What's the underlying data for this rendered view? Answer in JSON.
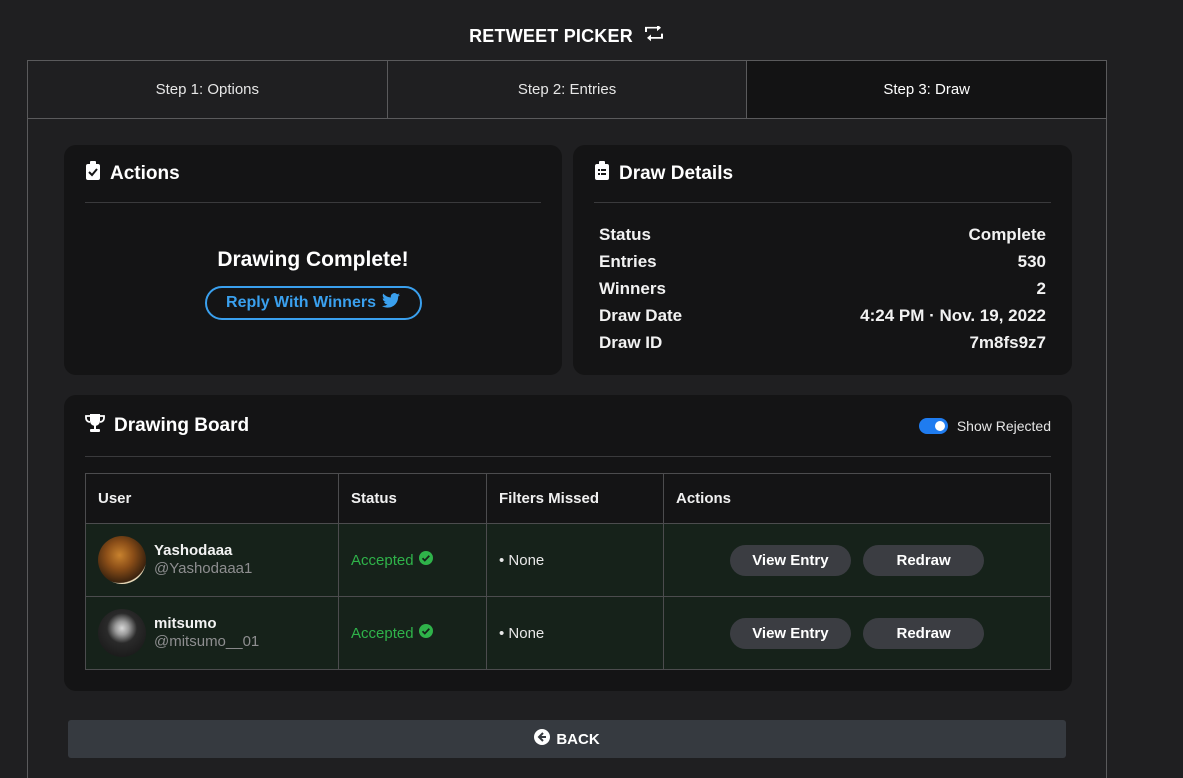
{
  "header": {
    "title": "RETWEET PICKER",
    "icon": "retweet-icon"
  },
  "tabs": [
    {
      "label": "Step 1: Options",
      "active": false
    },
    {
      "label": "Step 2: Entries",
      "active": false
    },
    {
      "label": "Step 3: Draw",
      "active": true
    }
  ],
  "actions_card": {
    "title": "Actions",
    "icon": "clipboard-check-icon",
    "message": "Drawing Complete!",
    "reply_button": "Reply With Winners",
    "reply_icon": "twitter-icon"
  },
  "details_card": {
    "title": "Draw Details",
    "icon": "clipboard-list-icon",
    "rows": [
      {
        "label": "Status",
        "value": "Complete"
      },
      {
        "label": "Entries",
        "value": "530"
      },
      {
        "label": "Winners",
        "value": "2"
      },
      {
        "label": "Draw Date",
        "value": "4:24 PM · Nov. 19, 2022"
      },
      {
        "label": "Draw ID",
        "value": "7m8fs9z7"
      }
    ]
  },
  "board": {
    "title": "Drawing Board",
    "icon": "trophy-icon",
    "toggle_label": "Show Rejected",
    "toggle_on": true,
    "columns": [
      "User",
      "Status",
      "Filters Missed",
      "Actions"
    ],
    "rows": [
      {
        "name": "Yashodaaa",
        "handle": "@Yashodaaa1",
        "status": "Accepted",
        "filters": "• None",
        "view_label": "View Entry",
        "redraw_label": "Redraw"
      },
      {
        "name": "mitsumo",
        "handle": "@mitsumo__01",
        "status": "Accepted",
        "filters": "• None",
        "view_label": "View Entry",
        "redraw_label": "Redraw"
      }
    ]
  },
  "back_button": "BACK",
  "colors": {
    "accent_blue": "#3aa0ee",
    "accepted_green": "#2fb34a",
    "toggle_blue": "#1f7cf0"
  }
}
